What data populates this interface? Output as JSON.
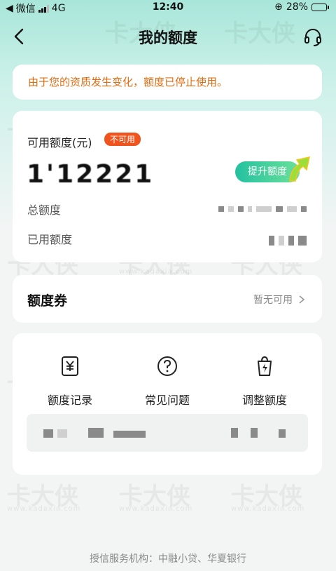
{
  "status_bar": {
    "carrier": "微信",
    "network": "4G",
    "time": "12:40",
    "battery": "28%"
  },
  "nav": {
    "title": "我的额度",
    "back_icon": "chevron-left-icon",
    "service_icon": "headset-icon"
  },
  "notice": {
    "text": "由于您的资质发生变化，额度已停止使用。"
  },
  "quota": {
    "available_label": "可用额度(元)",
    "badge": "不可用",
    "amount": "1'12221",
    "boost_button": "提升额度",
    "total_label": "总额度",
    "used_label": "已用额度"
  },
  "voucher": {
    "title": "额度券",
    "status": "暂无可用"
  },
  "menu": {
    "items": [
      {
        "label": "额度记录",
        "icon": "yen-receipt-icon"
      },
      {
        "label": "常见问题",
        "icon": "question-icon"
      },
      {
        "label": "调整额度",
        "icon": "lightning-bag-icon"
      }
    ]
  },
  "footer": {
    "text": "授信服务机构：中融小贷、华夏银行"
  },
  "watermark": {
    "brand": "卡大侠",
    "url": "www.kadaxia.com"
  },
  "colors": {
    "accent_orange": "#e06c12",
    "badge_red": "#f0541e",
    "boost_green": "#24c1a0"
  }
}
